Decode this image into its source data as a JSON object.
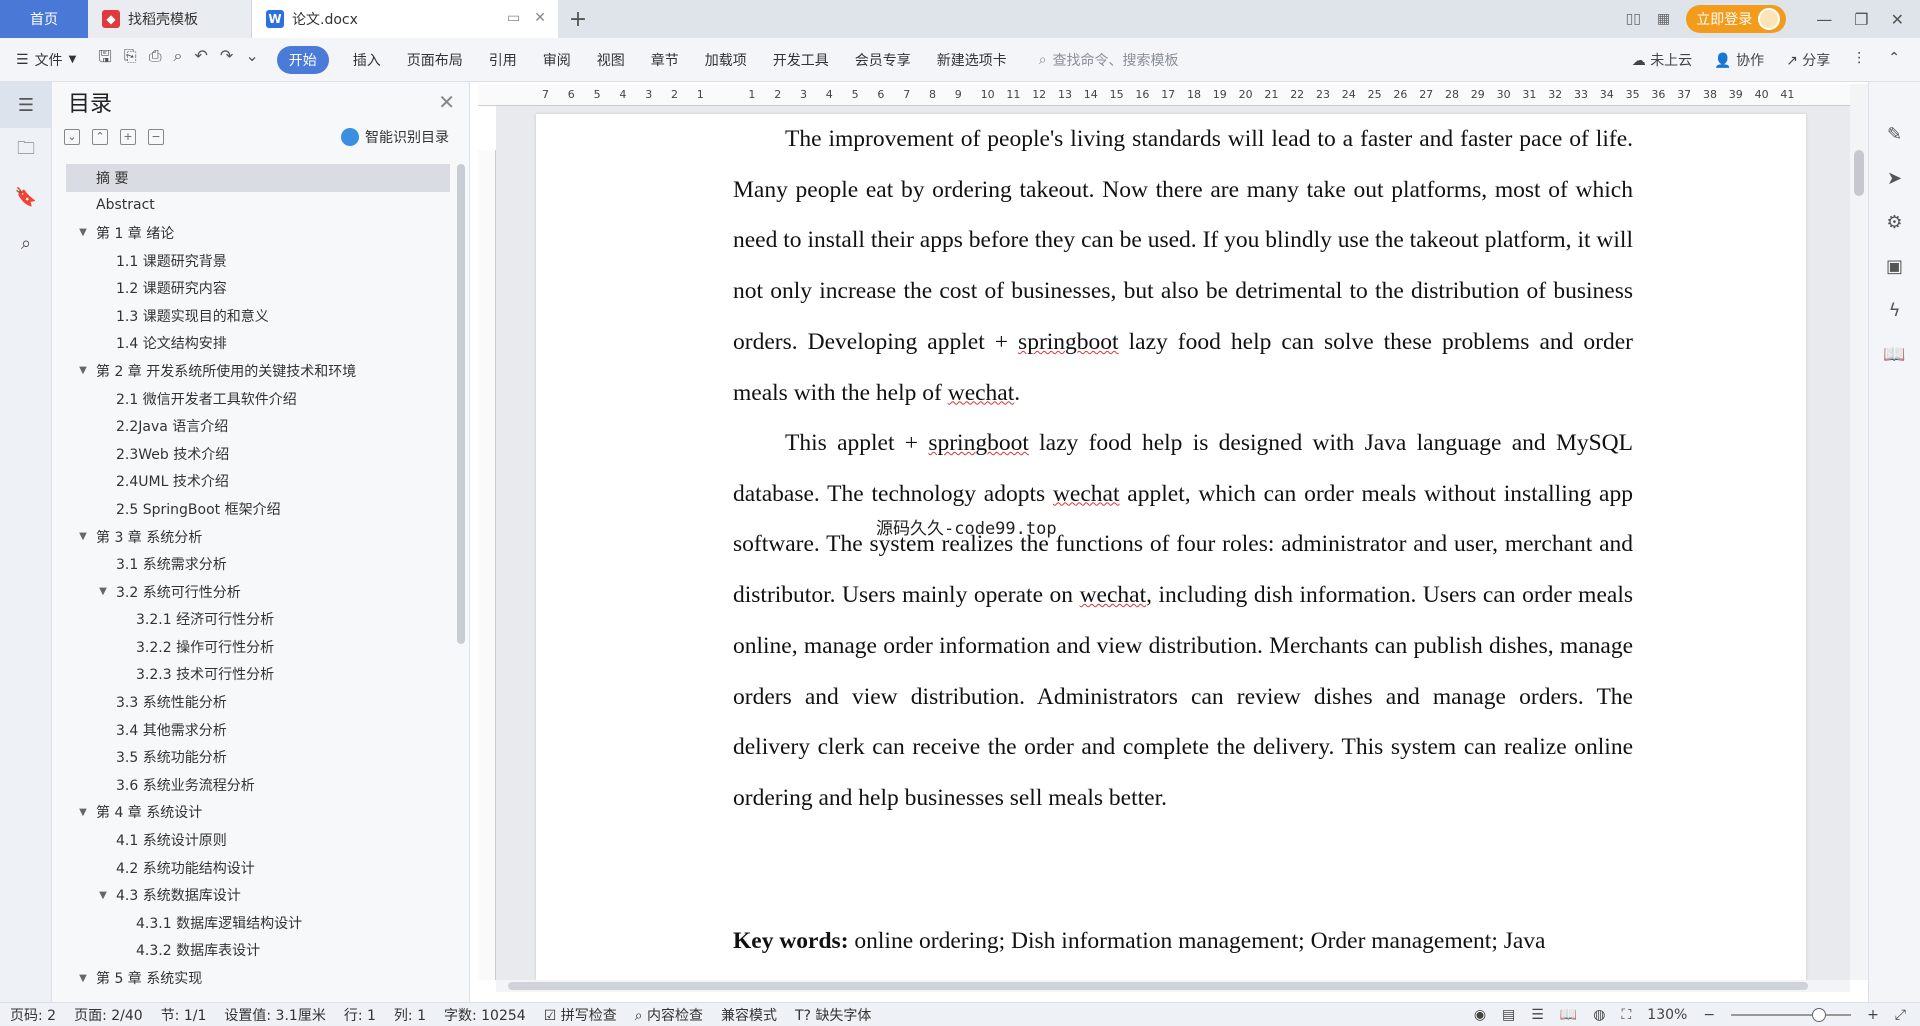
{
  "tabs": {
    "home": "首页",
    "docer": "找稻壳模板",
    "doc": "论文.docx",
    "login": "立即登录"
  },
  "ribbon": {
    "file": "文件",
    "start": "开始",
    "items": [
      "插入",
      "页面布局",
      "引用",
      "审阅",
      "视图",
      "章节",
      "加载项",
      "开发工具",
      "会员专享",
      "新建选项卡"
    ],
    "search_placeholder": "查找命令、搜索模板",
    "cloud": "未上云",
    "collab": "协作",
    "share": "分享"
  },
  "toc": {
    "title": "目录",
    "smart": "智能识别目录",
    "items": [
      {
        "label": "摘  要",
        "level": 1,
        "selected": true
      },
      {
        "label": "Abstract",
        "level": 1
      },
      {
        "label": "第 1 章  绪论",
        "level": 1,
        "arrow": true
      },
      {
        "label": "1.1 课题研究背景",
        "level": 2
      },
      {
        "label": "1.2 课题研究内容",
        "level": 2
      },
      {
        "label": "1.3 课题实现目的和意义",
        "level": 2
      },
      {
        "label": "1.4 论文结构安排",
        "level": 2
      },
      {
        "label": "第 2 章  开发系统所使用的关键技术和环境",
        "level": 1,
        "arrow": true
      },
      {
        "label": "2.1 微信开发者工具软件介绍",
        "level": 2
      },
      {
        "label": "2.2Java 语言介绍",
        "level": 2
      },
      {
        "label": "2.3Web 技术介绍",
        "level": 2
      },
      {
        "label": "2.4UML 技术介绍",
        "level": 2
      },
      {
        "label": "2.5 SpringBoot 框架介绍",
        "level": 2
      },
      {
        "label": "第 3 章  系统分析",
        "level": 1,
        "arrow": true
      },
      {
        "label": "3.1 系统需求分析",
        "level": 2
      },
      {
        "label": "3.2 系统可行性分析",
        "level": 2,
        "arrow": true
      },
      {
        "label": "3.2.1 经济可行性分析",
        "level": 3
      },
      {
        "label": "3.2.2 操作可行性分析",
        "level": 3
      },
      {
        "label": "3.2.3 技术可行性分析",
        "level": 3
      },
      {
        "label": "3.3 系统性能分析",
        "level": 2
      },
      {
        "label": "3.4 其他需求分析",
        "level": 2
      },
      {
        "label": "3.5 系统功能分析",
        "level": 2
      },
      {
        "label": "3.6 系统业务流程分析",
        "level": 2
      },
      {
        "label": "第 4 章  系统设计",
        "level": 1,
        "arrow": true
      },
      {
        "label": "4.1 系统设计原则",
        "level": 2
      },
      {
        "label": "4.2 系统功能结构设计",
        "level": 2
      },
      {
        "label": "4.3 系统数据库设计",
        "level": 2,
        "arrow": true
      },
      {
        "label": "4.3.1 数据库逻辑结构设计",
        "level": 3
      },
      {
        "label": "4.3.2 数据库表设计",
        "level": 3
      },
      {
        "label": "第 5 章  系统实现",
        "level": 1,
        "arrow": true
      }
    ]
  },
  "ruler": {
    "ticks": [
      "7",
      "6",
      "5",
      "4",
      "3",
      "2",
      "1",
      "",
      "1",
      "2",
      "3",
      "4",
      "5",
      "6",
      "7",
      "8",
      "9",
      "10",
      "11",
      "12",
      "13",
      "14",
      "15",
      "16",
      "17",
      "18",
      "19",
      "20",
      "21",
      "22",
      "23",
      "24",
      "25",
      "26",
      "27",
      "28",
      "29",
      "30",
      "31",
      "32",
      "33",
      "34",
      "35",
      "36",
      "37",
      "38",
      "39",
      "40",
      "41"
    ]
  },
  "document": {
    "p1_parts": [
      "The improvement of people's living standards will lead to a faster and faster pace of life. Many people eat by ordering takeout. Now there are many take out platforms, most of which need to install their apps before they can be used. If you blindly use the takeout platform, it will not only increase the cost of businesses, but also be detrimental to the distribution of business orders. Developing applet + ",
      "springboot",
      " lazy food help can solve these problems and order meals with the help of ",
      "wechat",
      "."
    ],
    "p2_parts": [
      "This applet + ",
      "springboot",
      " lazy food help is designed with Java language and MySQL database. The technology adopts ",
      "wechat",
      " applet, which can order meals without installing app software. The system realizes the functions of four roles: administrator and user, merchant and distributor. Users mainly operate on ",
      "wechat",
      ", including dish information. Users can order meals online, manage order information and view distribution. Merchants can publish dishes, manage orders and view distribution. Administrators can review dishes and manage orders. The delivery clerk can receive the order and complete the delivery. This system can realize online ordering and help businesses sell meals better."
    ],
    "watermark": "源码久久-code99.top",
    "keywords_label": "Key words:",
    "keywords_text": " online ordering; Dish information management; Order management; Java"
  },
  "status": {
    "page": "页码: 2",
    "pages": "页面: 2/40",
    "section": "节: 1/1",
    "setting": "设置值: 3.1厘米",
    "row": "行: 1",
    "col": "列: 1",
    "words": "字数: 10254",
    "spell": "拼写检查",
    "content": "内容检查",
    "compat": "兼容模式",
    "missing_font": "缺失字体",
    "zoom": "130%",
    "zoom_fraction": 0.73
  }
}
